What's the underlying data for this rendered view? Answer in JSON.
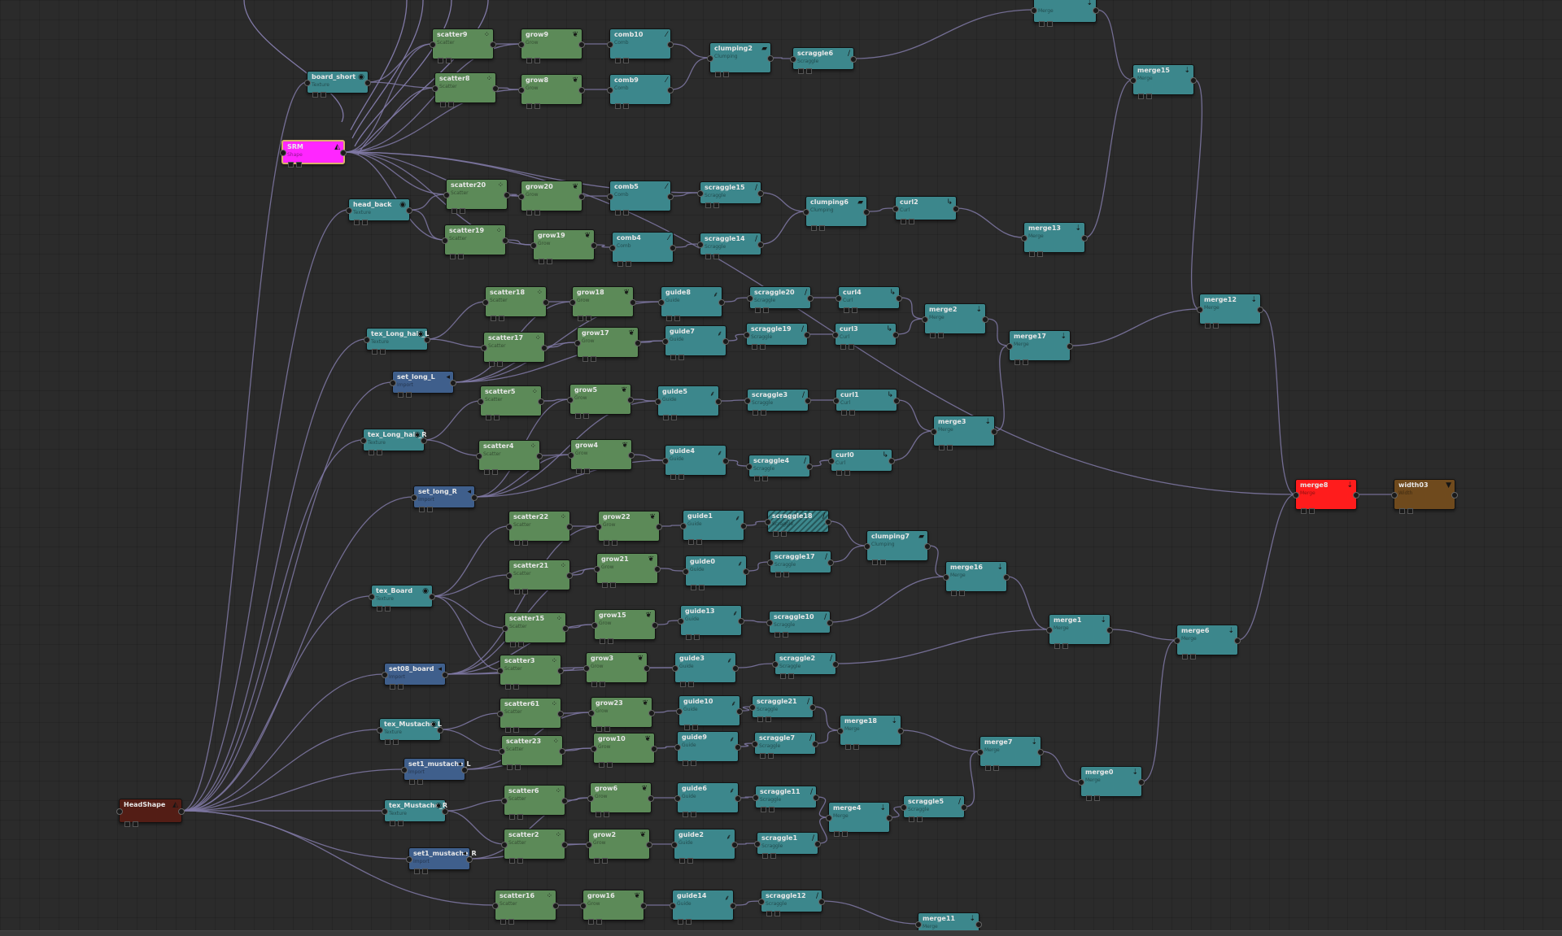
{
  "colors": {
    "background": "#2b2b2b",
    "wire": "#8079a6",
    "guide": "#3c878c",
    "scatter": "#5c8a58",
    "set": "#3f5f8c",
    "shape": "#531d15",
    "selected": "#ff26ff",
    "output": "#ff1c1c",
    "width": "#6f4a1d"
  },
  "nodes": [
    {
      "id": "merge_top",
      "label": "",
      "type": "Merge",
      "icon": "merge-icon"
    },
    {
      "id": "scatter9",
      "label": "scatter9",
      "type": "Scatter",
      "icon": "scatter-icon"
    },
    {
      "id": "grow9",
      "label": "grow9",
      "type": "Grow",
      "icon": "grow-icon"
    },
    {
      "id": "comb10",
      "label": "comb10",
      "type": "Comb",
      "icon": "comb-icon"
    },
    {
      "id": "clumping2",
      "label": "clumping2",
      "type": "Clumping",
      "icon": "clumping-icon"
    },
    {
      "id": "scraggle6",
      "label": "scraggle6",
      "type": "Scraggle",
      "icon": "scraggle-icon"
    },
    {
      "id": "board_short",
      "label": "board_short",
      "type": "Texture",
      "icon": "texture-icon"
    },
    {
      "id": "scatter8",
      "label": "scatter8",
      "type": "Scatter",
      "icon": "scatter-icon"
    },
    {
      "id": "grow8",
      "label": "grow8",
      "type": "Grow",
      "icon": "grow-icon"
    },
    {
      "id": "comb9",
      "label": "comb9",
      "type": "Comb",
      "icon": "comb-icon"
    },
    {
      "id": "merge15",
      "label": "merge15",
      "type": "Merge",
      "icon": "merge-icon"
    },
    {
      "id": "SRM",
      "label": "SRM",
      "type": "Shape",
      "icon": "shape-icon"
    },
    {
      "id": "scatter20",
      "label": "scatter20",
      "type": "Scatter",
      "icon": "scatter-icon"
    },
    {
      "id": "grow20",
      "label": "grow20",
      "type": "Grow",
      "icon": "grow-icon"
    },
    {
      "id": "comb5",
      "label": "comb5",
      "type": "Comb",
      "icon": "comb-icon"
    },
    {
      "id": "scraggle15",
      "label": "scraggle15",
      "type": "Scraggle",
      "icon": "scraggle-icon"
    },
    {
      "id": "head_back",
      "label": "head_back",
      "type": "Texture",
      "icon": "texture-icon"
    },
    {
      "id": "clumping6",
      "label": "clumping6",
      "type": "Clumping",
      "icon": "clumping-icon"
    },
    {
      "id": "curl2",
      "label": "curl2",
      "type": "Curl",
      "icon": "curl-icon"
    },
    {
      "id": "scatter19",
      "label": "scatter19",
      "type": "Scatter",
      "icon": "scatter-icon"
    },
    {
      "id": "grow19",
      "label": "grow19",
      "type": "Grow",
      "icon": "grow-icon"
    },
    {
      "id": "comb4",
      "label": "comb4",
      "type": "Comb",
      "icon": "comb-icon"
    },
    {
      "id": "scraggle14",
      "label": "scraggle14",
      "type": "Scraggle",
      "icon": "scraggle-icon"
    },
    {
      "id": "merge13",
      "label": "merge13",
      "type": "Merge",
      "icon": "merge-icon"
    },
    {
      "id": "scatter18",
      "label": "scatter18",
      "type": "Scatter",
      "icon": "scatter-icon"
    },
    {
      "id": "grow18",
      "label": "grow18",
      "type": "Grow",
      "icon": "grow-icon"
    },
    {
      "id": "guide8",
      "label": "guide8",
      "type": "Guide",
      "icon": "guide-icon"
    },
    {
      "id": "scraggle20",
      "label": "scraggle20",
      "type": "Scraggle",
      "icon": "scraggle-icon"
    },
    {
      "id": "curl4",
      "label": "curl4",
      "type": "Curl",
      "icon": "curl-icon"
    },
    {
      "id": "merge2",
      "label": "merge2",
      "type": "Merge",
      "icon": "merge-icon"
    },
    {
      "id": "merge12",
      "label": "merge12",
      "type": "Merge",
      "icon": "merge-icon"
    },
    {
      "id": "tex_long_hair_l",
      "label": "tex_Long_hair_L",
      "type": "Texture",
      "icon": "texture-icon"
    },
    {
      "id": "scatter17",
      "label": "scatter17",
      "type": "Scatter",
      "icon": "scatter-icon"
    },
    {
      "id": "grow17",
      "label": "grow17",
      "type": "Grow",
      "icon": "grow-icon"
    },
    {
      "id": "guide7",
      "label": "guide7",
      "type": "Guide",
      "icon": "guide-icon"
    },
    {
      "id": "scraggle19",
      "label": "scraggle19",
      "type": "Scraggle",
      "icon": "scraggle-icon"
    },
    {
      "id": "curl3",
      "label": "curl3",
      "type": "Curl",
      "icon": "curl-icon"
    },
    {
      "id": "merge17",
      "label": "merge17",
      "type": "Merge",
      "icon": "merge-icon"
    },
    {
      "id": "set_long_l",
      "label": "set_long_L",
      "type": "Import",
      "icon": "set-icon"
    },
    {
      "id": "scatter5",
      "label": "scatter5",
      "type": "Scatter",
      "icon": "scatter-icon"
    },
    {
      "id": "grow5",
      "label": "grow5",
      "type": "Grow",
      "icon": "grow-icon"
    },
    {
      "id": "guide5",
      "label": "guide5",
      "type": "Guide",
      "icon": "guide-icon"
    },
    {
      "id": "scraggle3",
      "label": "scraggle3",
      "type": "Scraggle",
      "icon": "scraggle-icon"
    },
    {
      "id": "curl1",
      "label": "curl1",
      "type": "Curl",
      "icon": "curl-icon"
    },
    {
      "id": "merge3",
      "label": "merge3",
      "type": "Merge",
      "icon": "merge-icon"
    },
    {
      "id": "tex_long_hair_r",
      "label": "tex_Long_hair_R",
      "type": "Texture",
      "icon": "texture-icon"
    },
    {
      "id": "scatter4",
      "label": "scatter4",
      "type": "Scatter",
      "icon": "scatter-icon"
    },
    {
      "id": "grow4",
      "label": "grow4",
      "type": "Grow",
      "icon": "grow-icon"
    },
    {
      "id": "guide4",
      "label": "guide4",
      "type": "Guide",
      "icon": "guide-icon"
    },
    {
      "id": "scraggle4",
      "label": "scraggle4",
      "type": "Scraggle",
      "icon": "scraggle-icon"
    },
    {
      "id": "curl0",
      "label": "curl0",
      "type": "Curl",
      "icon": "curl-icon"
    },
    {
      "id": "set_long_r",
      "label": "set_long_R",
      "type": "Import",
      "icon": "set-icon"
    },
    {
      "id": "merge8",
      "label": "merge8",
      "type": "Merge",
      "icon": "merge-icon"
    },
    {
      "id": "width03",
      "label": "width03",
      "type": "Width",
      "icon": "width-icon"
    },
    {
      "id": "scatter22",
      "label": "scatter22",
      "type": "Scatter",
      "icon": "scatter-icon"
    },
    {
      "id": "grow22",
      "label": "grow22",
      "type": "Grow",
      "icon": "grow-icon"
    },
    {
      "id": "guide1",
      "label": "guide1",
      "type": "Guide",
      "icon": "guide-icon"
    },
    {
      "id": "scraggle18",
      "label": "scraggle18",
      "type": "Scraggle",
      "icon": "scraggle-icon"
    },
    {
      "id": "clumping7",
      "label": "clumping7",
      "type": "Clumping",
      "icon": "clumping-icon"
    },
    {
      "id": "scatter21",
      "label": "scatter21",
      "type": "Scatter",
      "icon": "scatter-icon"
    },
    {
      "id": "grow21",
      "label": "grow21",
      "type": "Grow",
      "icon": "grow-icon"
    },
    {
      "id": "guide0",
      "label": "guide0",
      "type": "Guide",
      "icon": "guide-icon"
    },
    {
      "id": "scraggle17",
      "label": "scraggle17",
      "type": "Scraggle",
      "icon": "scraggle-icon"
    },
    {
      "id": "merge16",
      "label": "merge16",
      "type": "Merge",
      "icon": "merge-icon"
    },
    {
      "id": "tex_board",
      "label": "tex_Board",
      "type": "Texture",
      "icon": "texture-icon"
    },
    {
      "id": "scatter15",
      "label": "scatter15",
      "type": "Scatter",
      "icon": "scatter-icon"
    },
    {
      "id": "grow15",
      "label": "grow15",
      "type": "Grow",
      "icon": "grow-icon"
    },
    {
      "id": "guide13",
      "label": "guide13",
      "type": "Guide",
      "icon": "guide-icon"
    },
    {
      "id": "scraggle10",
      "label": "scraggle10",
      "type": "Scraggle",
      "icon": "scraggle-icon"
    },
    {
      "id": "merge1",
      "label": "merge1",
      "type": "Merge",
      "icon": "merge-icon"
    },
    {
      "id": "merge6",
      "label": "merge6",
      "type": "Merge",
      "icon": "merge-icon"
    },
    {
      "id": "set08_board",
      "label": "set08_board",
      "type": "Import",
      "icon": "set-icon"
    },
    {
      "id": "scatter3",
      "label": "scatter3",
      "type": "Scatter",
      "icon": "scatter-icon"
    },
    {
      "id": "grow3",
      "label": "grow3",
      "type": "Grow",
      "icon": "grow-icon"
    },
    {
      "id": "guide3",
      "label": "guide3",
      "type": "Guide",
      "icon": "guide-icon"
    },
    {
      "id": "scraggle2",
      "label": "scraggle2",
      "type": "Scraggle",
      "icon": "scraggle-icon"
    },
    {
      "id": "tex_mustache_l",
      "label": "tex_Mustache_L",
      "type": "Texture",
      "icon": "texture-icon"
    },
    {
      "id": "scatter61",
      "label": "scatter61",
      "type": "Scatter",
      "icon": "scatter-icon"
    },
    {
      "id": "grow23",
      "label": "grow23",
      "type": "Grow",
      "icon": "grow-icon"
    },
    {
      "id": "guide10",
      "label": "guide10",
      "type": "Guide",
      "icon": "guide-icon"
    },
    {
      "id": "scraggle21",
      "label": "scraggle21",
      "type": "Scraggle",
      "icon": "scraggle-icon"
    },
    {
      "id": "merge18",
      "label": "merge18",
      "type": "Merge",
      "icon": "merge-icon"
    },
    {
      "id": "set1_mustache_l",
      "label": "set1_mustache_L",
      "type": "Import",
      "icon": "set-icon"
    },
    {
      "id": "scatter23",
      "label": "scatter23",
      "type": "Scatter",
      "icon": "scatter-icon"
    },
    {
      "id": "grow10",
      "label": "grow10",
      "type": "Grow",
      "icon": "grow-icon"
    },
    {
      "id": "guide9",
      "label": "guide9",
      "type": "Guide",
      "icon": "guide-icon"
    },
    {
      "id": "scraggle7",
      "label": "scraggle7",
      "type": "Scraggle",
      "icon": "scraggle-icon"
    },
    {
      "id": "merge7",
      "label": "merge7",
      "type": "Merge",
      "icon": "merge-icon"
    },
    {
      "id": "merge0",
      "label": "merge0",
      "type": "Merge",
      "icon": "merge-icon"
    },
    {
      "id": "headshape",
      "label": "HeadShape",
      "type": "",
      "icon": "shape-icon"
    },
    {
      "id": "tex_mustache_r",
      "label": "tex_Mustache_R",
      "type": "Texture",
      "icon": "texture-icon"
    },
    {
      "id": "scatter6",
      "label": "scatter6",
      "type": "Scatter",
      "icon": "scatter-icon"
    },
    {
      "id": "grow6",
      "label": "grow6",
      "type": "Grow",
      "icon": "grow-icon"
    },
    {
      "id": "guide6",
      "label": "guide6",
      "type": "Guide",
      "icon": "guide-icon"
    },
    {
      "id": "scraggle11",
      "label": "scraggle11",
      "type": "Scraggle",
      "icon": "scraggle-icon"
    },
    {
      "id": "merge4",
      "label": "merge4",
      "type": "Merge",
      "icon": "merge-icon"
    },
    {
      "id": "scraggle5",
      "label": "scraggle5",
      "type": "Scraggle",
      "icon": "scraggle-icon"
    },
    {
      "id": "scatter2",
      "label": "scatter2",
      "type": "Scatter",
      "icon": "scatter-icon"
    },
    {
      "id": "grow2",
      "label": "grow2",
      "type": "Grow",
      "icon": "grow-icon"
    },
    {
      "id": "guide2",
      "label": "guide2",
      "type": "Guide",
      "icon": "guide-icon"
    },
    {
      "id": "scraggle1",
      "label": "scraggle1",
      "type": "Scraggle",
      "icon": "scraggle-icon"
    },
    {
      "id": "set1_mustache_r",
      "label": "set1_mustache_R",
      "type": "Import",
      "icon": "set-icon"
    },
    {
      "id": "scatter16",
      "label": "scatter16",
      "type": "Scatter",
      "icon": "scatter-icon"
    },
    {
      "id": "grow16",
      "label": "grow16",
      "type": "Grow",
      "icon": "grow-icon"
    },
    {
      "id": "guide14",
      "label": "guide14",
      "type": "Guide",
      "icon": "guide-icon"
    },
    {
      "id": "scraggle12",
      "label": "scraggle12",
      "type": "Scraggle",
      "icon": "scraggle-icon"
    },
    {
      "id": "merge11",
      "label": "merge11",
      "type": "Merge",
      "icon": "merge-icon"
    }
  ],
  "edges": [
    [
      "scatter9",
      "grow9"
    ],
    [
      "grow9",
      "comb10"
    ],
    [
      "comb10",
      "clumping2"
    ],
    [
      "clumping2",
      "scraggle6"
    ],
    [
      "scraggle6",
      "merge_top"
    ],
    [
      "scatter8",
      "grow8"
    ],
    [
      "grow8",
      "comb9"
    ],
    [
      "comb9",
      "clumping2"
    ],
    [
      "board_short",
      "scatter9"
    ],
    [
      "board_short",
      "scatter8"
    ],
    [
      "SRM",
      "scatter9"
    ],
    [
      "SRM",
      "scatter8"
    ],
    [
      "SRM",
      "grow9"
    ],
    [
      "SRM",
      "grow8"
    ],
    [
      "SRM",
      "scatter20"
    ],
    [
      "SRM",
      "scatter19"
    ],
    [
      "SRM",
      "grow20"
    ],
    [
      "SRM",
      "grow19"
    ],
    [
      "SRM",
      "scraggle15"
    ],
    [
      "SRM",
      "merge8"
    ],
    [
      "head_back",
      "scatter20"
    ],
    [
      "head_back",
      "scatter19"
    ],
    [
      "scatter20",
      "grow20"
    ],
    [
      "grow20",
      "comb5"
    ],
    [
      "comb5",
      "scraggle15"
    ],
    [
      "scraggle15",
      "clumping6"
    ],
    [
      "clumping6",
      "curl2"
    ],
    [
      "curl2",
      "merge13"
    ],
    [
      "scatter19",
      "grow19"
    ],
    [
      "grow19",
      "comb4"
    ],
    [
      "comb4",
      "scraggle14"
    ],
    [
      "scraggle14",
      "clumping6"
    ],
    [
      "merge13",
      "merge15"
    ],
    [
      "merge_top",
      "merge15"
    ],
    [
      "merge15",
      "merge12"
    ],
    [
      "merge12",
      "merge8"
    ],
    [
      "tex_long_hair_l",
      "scatter18"
    ],
    [
      "tex_long_hair_l",
      "scatter17"
    ],
    [
      "scatter18",
      "grow18"
    ],
    [
      "grow18",
      "guide8"
    ],
    [
      "guide8",
      "scraggle20"
    ],
    [
      "scraggle20",
      "curl4"
    ],
    [
      "curl4",
      "merge2"
    ],
    [
      "scatter17",
      "grow17"
    ],
    [
      "grow17",
      "guide7"
    ],
    [
      "guide7",
      "scraggle19"
    ],
    [
      "scraggle19",
      "curl3"
    ],
    [
      "curl3",
      "merge2"
    ],
    [
      "set_long_l",
      "grow18"
    ],
    [
      "set_long_l",
      "grow17"
    ],
    [
      "set_long_l",
      "guide8"
    ],
    [
      "set_long_l",
      "guide7"
    ],
    [
      "merge2",
      "merge17"
    ],
    [
      "merge17",
      "merge12"
    ],
    [
      "tex_long_hair_r",
      "scatter5"
    ],
    [
      "tex_long_hair_r",
      "scatter4"
    ],
    [
      "scatter5",
      "grow5"
    ],
    [
      "grow5",
      "guide5"
    ],
    [
      "guide5",
      "scraggle3"
    ],
    [
      "scraggle3",
      "curl1"
    ],
    [
      "curl1",
      "merge3"
    ],
    [
      "scatter4",
      "grow4"
    ],
    [
      "grow4",
      "guide4"
    ],
    [
      "guide4",
      "scraggle4"
    ],
    [
      "scraggle4",
      "curl0"
    ],
    [
      "curl0",
      "merge3"
    ],
    [
      "set_long_r",
      "grow5"
    ],
    [
      "set_long_r",
      "grow4"
    ],
    [
      "set_long_r",
      "guide5"
    ],
    [
      "set_long_r",
      "guide4"
    ],
    [
      "merge3",
      "merge17"
    ],
    [
      "merge8",
      "width03"
    ],
    [
      "tex_board",
      "scatter22"
    ],
    [
      "tex_board",
      "scatter21"
    ],
    [
      "tex_board",
      "scatter15"
    ],
    [
      "tex_board",
      "scatter3"
    ],
    [
      "scatter22",
      "grow22"
    ],
    [
      "grow22",
      "guide1"
    ],
    [
      "guide1",
      "scraggle18"
    ],
    [
      "scraggle18",
      "clumping7"
    ],
    [
      "scatter21",
      "grow21"
    ],
    [
      "grow21",
      "guide0"
    ],
    [
      "guide0",
      "scraggle17"
    ],
    [
      "scraggle17",
      "clumping7"
    ],
    [
      "clumping7",
      "merge16"
    ],
    [
      "merge16",
      "merge1"
    ],
    [
      "scatter15",
      "grow15"
    ],
    [
      "grow15",
      "guide13"
    ],
    [
      "guide13",
      "scraggle10"
    ],
    [
      "scraggle10",
      "merge16"
    ],
    [
      "set08_board",
      "grow22"
    ],
    [
      "set08_board",
      "grow21"
    ],
    [
      "set08_board",
      "grow15"
    ],
    [
      "set08_board",
      "grow3"
    ],
    [
      "set08_board",
      "guide3"
    ],
    [
      "scatter3",
      "grow3"
    ],
    [
      "grow3",
      "guide3"
    ],
    [
      "guide3",
      "scraggle2"
    ],
    [
      "scraggle2",
      "merge1"
    ],
    [
      "merge1",
      "merge6"
    ],
    [
      "merge6",
      "merge8"
    ],
    [
      "tex_mustache_l",
      "scatter61"
    ],
    [
      "tex_mustache_l",
      "scatter23"
    ],
    [
      "scatter61",
      "grow23"
    ],
    [
      "grow23",
      "guide10"
    ],
    [
      "guide10",
      "scraggle21"
    ],
    [
      "scraggle21",
      "merge18"
    ],
    [
      "scatter23",
      "grow10"
    ],
    [
      "grow10",
      "guide9"
    ],
    [
      "guide9",
      "scraggle7"
    ],
    [
      "scraggle7",
      "merge18"
    ],
    [
      "set1_mustache_l",
      "grow23"
    ],
    [
      "set1_mustache_l",
      "grow10"
    ],
    [
      "merge18",
      "merge7"
    ],
    [
      "merge7",
      "merge0"
    ],
    [
      "merge0",
      "merge6"
    ],
    [
      "tex_mustache_r",
      "scatter6"
    ],
    [
      "tex_mustache_r",
      "scatter2"
    ],
    [
      "scatter6",
      "grow6"
    ],
    [
      "grow6",
      "guide6"
    ],
    [
      "guide6",
      "scraggle11"
    ],
    [
      "scraggle11",
      "merge4"
    ],
    [
      "scatter2",
      "grow2"
    ],
    [
      "grow2",
      "guide2"
    ],
    [
      "guide2",
      "scraggle1"
    ],
    [
      "scraggle1",
      "merge4"
    ],
    [
      "set1_mustache_r",
      "grow6"
    ],
    [
      "set1_mustache_r",
      "grow2"
    ],
    [
      "merge4",
      "scraggle5"
    ],
    [
      "scraggle5",
      "merge7"
    ],
    [
      "scatter16",
      "grow16"
    ],
    [
      "grow16",
      "guide14"
    ],
    [
      "guide14",
      "scraggle12"
    ],
    [
      "scraggle12",
      "merge11"
    ],
    [
      "headshape",
      "board_short"
    ],
    [
      "headshape",
      "head_back"
    ],
    [
      "headshape",
      "tex_long_hair_l"
    ],
    [
      "headshape",
      "set_long_l"
    ],
    [
      "headshape",
      "tex_long_hair_r"
    ],
    [
      "headshape",
      "set_long_r"
    ],
    [
      "headshape",
      "tex_board"
    ],
    [
      "headshape",
      "set08_board"
    ],
    [
      "headshape",
      "tex_mustache_l"
    ],
    [
      "headshape",
      "set1_mustache_l"
    ],
    [
      "headshape",
      "tex_mustache_r"
    ],
    [
      "headshape",
      "set1_mustache_r"
    ],
    [
      "headshape",
      "scatter16"
    ]
  ]
}
